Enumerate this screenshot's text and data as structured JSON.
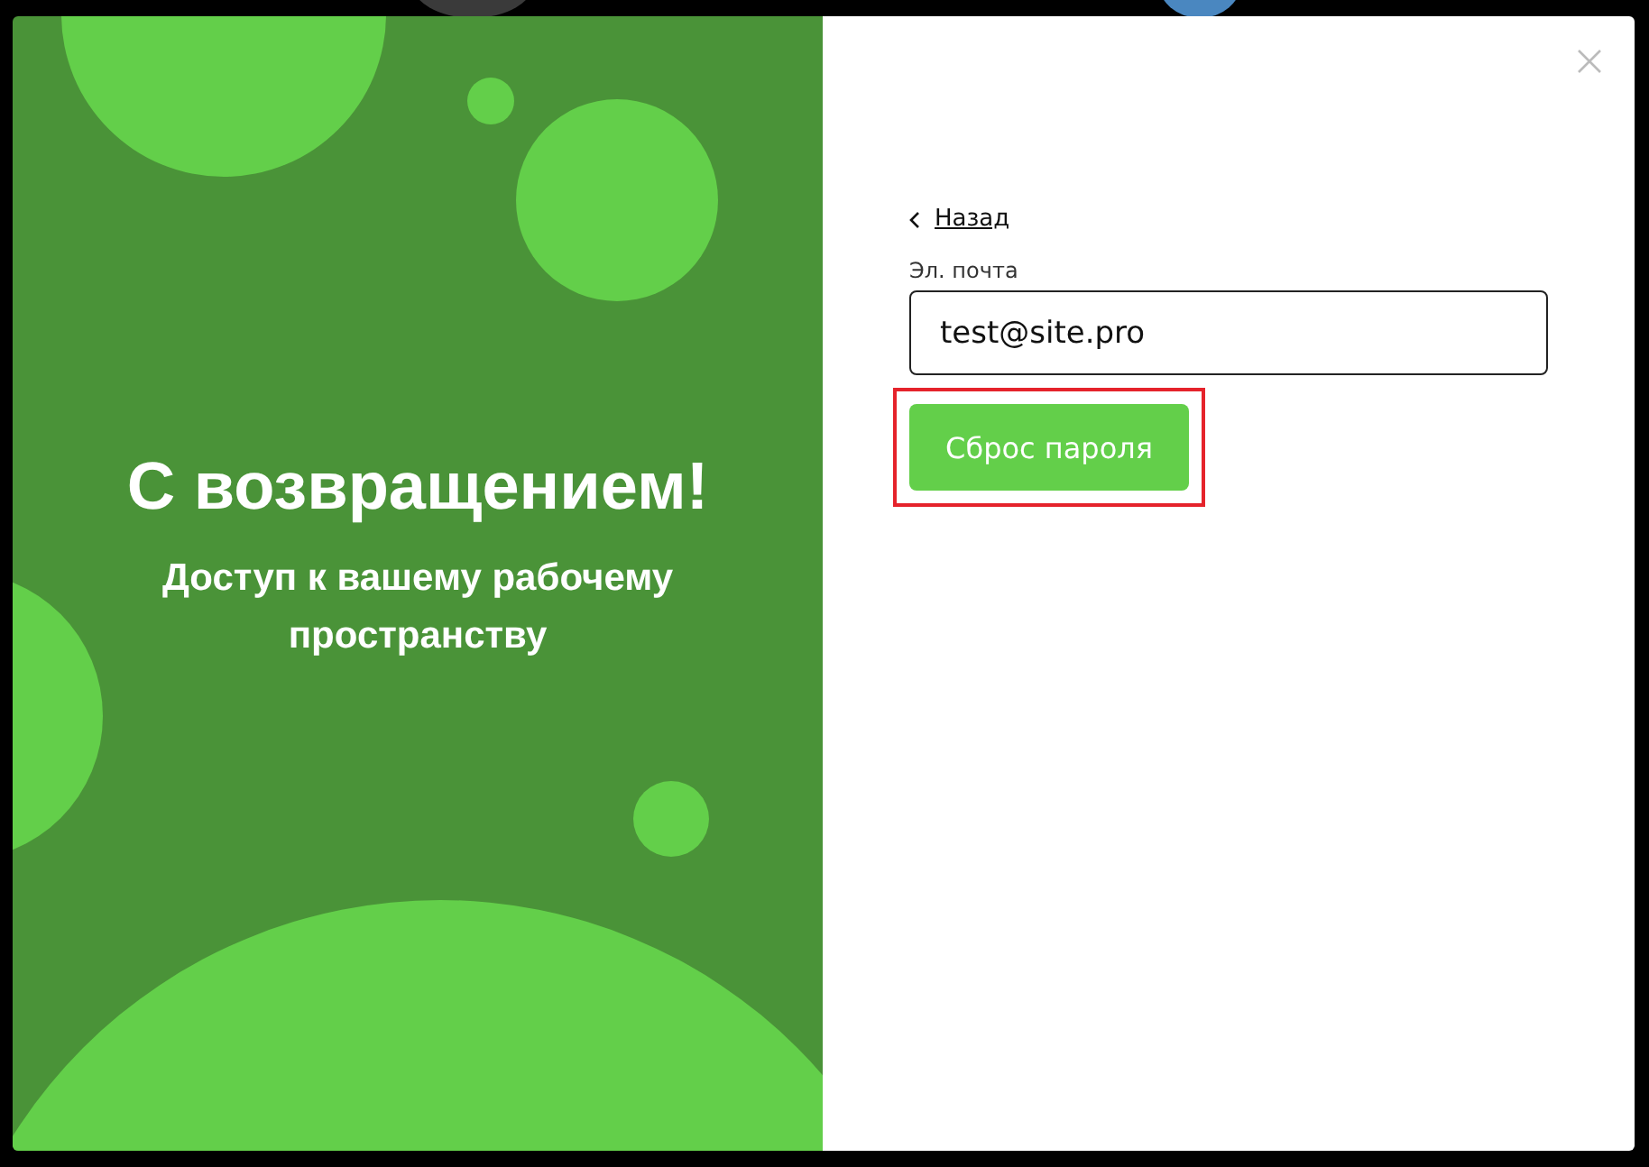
{
  "welcome": {
    "title": "С возвращением!",
    "subtitle": "Доступ к вашему рабочему пространству"
  },
  "form": {
    "back_link": "Назад",
    "email_label": "Эл. почта",
    "email_value": "test@site.pro",
    "submit_button": "Сброс пароля",
    "submit_highlighted": true
  }
}
